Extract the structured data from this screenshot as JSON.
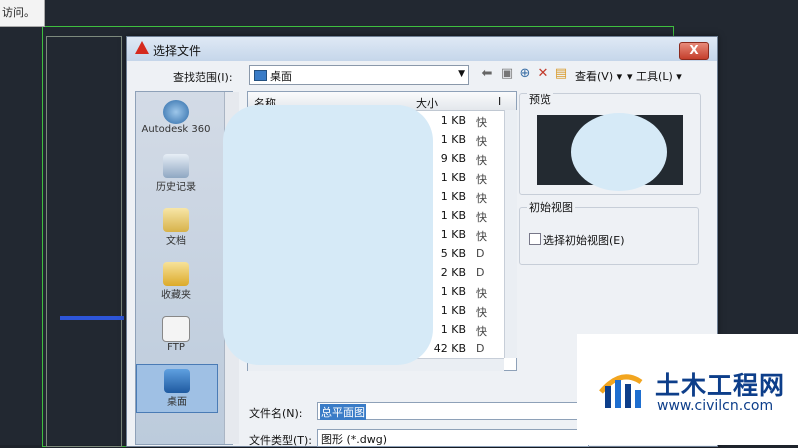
{
  "topbar_text": "访问。",
  "dialog": {
    "title": "选择文件",
    "close_label": "X",
    "look_in_label": "查找范围(I):",
    "look_in_value": "桌面",
    "view_label": "查看(V)",
    "tools_label": "工具(L)",
    "places": [
      "Autodesk 360",
      "历史记录",
      "文档",
      "收藏夹",
      "FTP",
      "桌面"
    ],
    "columns": {
      "name": "名称",
      "size": "大小",
      "type": "I"
    },
    "files": [
      {
        "size": "1 KB",
        "type": "快"
      },
      {
        "size": "1 KB",
        "type": "快"
      },
      {
        "size": "9 KB",
        "type": "快"
      },
      {
        "size": "1 KB",
        "type": "快"
      },
      {
        "size": "1 KB",
        "type": "快"
      },
      {
        "size": "1 KB",
        "type": "快"
      },
      {
        "size": "1 KB",
        "type": "快"
      },
      {
        "size": "5 KB",
        "type": "D"
      },
      {
        "size": "2 KB",
        "type": "D"
      },
      {
        "size": "1 KB",
        "type": "快"
      },
      {
        "size": "1 KB",
        "type": "快"
      },
      {
        "size": "1 KB",
        "type": "快"
      },
      {
        "size": "42 KB",
        "type": "D"
      }
    ],
    "preview_label": "预览",
    "initial_view_label": "初始视图",
    "select_initial_view_label": "选择初始视图(E)",
    "file_name_label": "文件名(N):",
    "file_name_value": "总平面图",
    "file_type_label": "文件类型(T):",
    "file_type_value": "图形 (*.dwg)"
  },
  "watermark": {
    "title": "土木工程网",
    "url": "www.civilcn.com"
  }
}
